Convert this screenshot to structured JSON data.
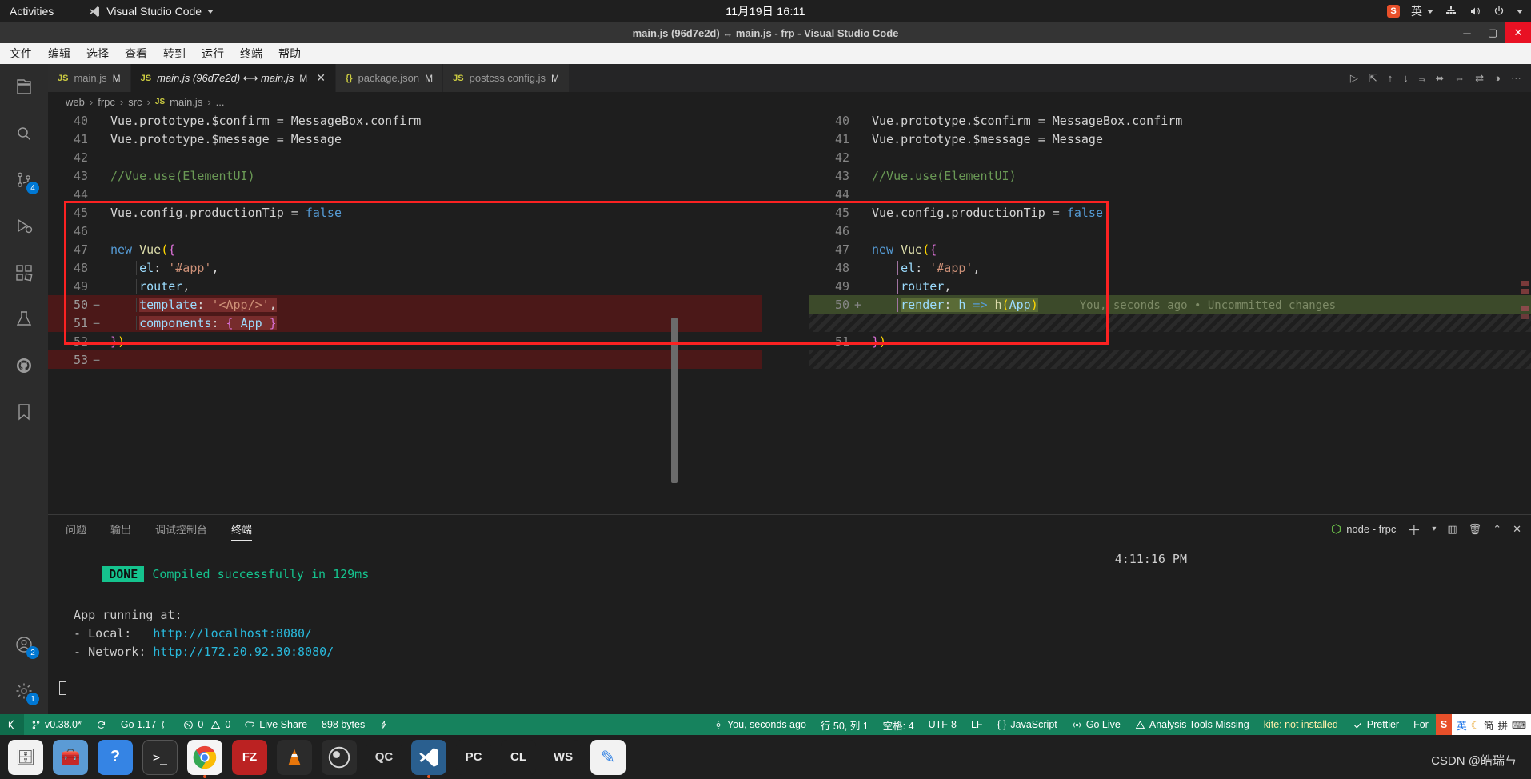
{
  "gnome": {
    "activities": "Activities",
    "app_name": "Visual Studio Code",
    "app_icon": "vscode-icon",
    "clock": "11月19日  16:11",
    "tray": [
      "sogou-ime-icon",
      "input-method-en",
      "network-icon",
      "volume-icon",
      "power-icon",
      "chevron-down-icon"
    ],
    "ime_label": "英"
  },
  "titlebar": {
    "title": "main.js (96d7e2d) ↔ main.js - frp - Visual Studio Code",
    "minimize": "─",
    "maximize": "▢",
    "close": "✕"
  },
  "menubar": {
    "items": [
      "文件",
      "编辑",
      "选择",
      "查看",
      "转到",
      "运行",
      "终端",
      "帮助"
    ]
  },
  "activitybar": {
    "items": [
      {
        "name": "explorer-icon",
        "glyph": "files",
        "badge": null,
        "active": false
      },
      {
        "name": "search-icon",
        "glyph": "search",
        "badge": null,
        "active": false
      },
      {
        "name": "source-control-icon",
        "glyph": "git",
        "badge": "4",
        "active": false
      },
      {
        "name": "run-debug-icon",
        "glyph": "debug",
        "badge": null,
        "active": false
      },
      {
        "name": "extensions-icon",
        "glyph": "ext",
        "badge": null,
        "active": false
      },
      {
        "name": "testing-icon",
        "glyph": "beaker",
        "badge": null,
        "active": false
      },
      {
        "name": "github-icon",
        "glyph": "github",
        "badge": null,
        "active": false
      },
      {
        "name": "bookmarks-icon",
        "glyph": "bookmark",
        "badge": null,
        "active": false
      }
    ],
    "bottom": [
      {
        "name": "accounts-icon",
        "glyph": "account",
        "badge": "2"
      },
      {
        "name": "settings-gear-icon",
        "glyph": "gear",
        "badge": "1"
      }
    ]
  },
  "tabs": [
    {
      "label": "main.js",
      "icon": "js-file-icon",
      "icon_text": "JS",
      "dirty": "M",
      "active": false,
      "closable": false
    },
    {
      "label": "main.js (96d7e2d) ⟷ main.js",
      "icon": "js-file-icon",
      "icon_text": "JS",
      "dirty": "M",
      "active": true,
      "closable": true
    },
    {
      "label": "package.json",
      "icon": "json-file-icon",
      "icon_text": "{}",
      "dirty": "M",
      "active": false,
      "closable": false
    },
    {
      "label": "postcss.config.js",
      "icon": "js-file-icon",
      "icon_text": "JS",
      "dirty": "M",
      "active": false,
      "closable": false
    }
  ],
  "editor_actions": [
    "run-icon",
    "split-editor-icon",
    "prev-change-icon",
    "next-change-icon",
    "filter-icon",
    "toggle-inline-icon",
    "collapse-unchanged-icon",
    "swap-sides-icon",
    "layout-icon",
    "more-actions-icon"
  ],
  "breadcrumb": [
    "web",
    "frpc",
    "src",
    "main.js",
    "..."
  ],
  "breadcrumb_file_icon": "JS",
  "diff": {
    "left_lines": [
      {
        "n": "40",
        "sign": "",
        "state": "ctx",
        "tokens": [
          {
            "t": "Vue",
            "c": "tok-plain"
          },
          {
            "t": ".",
            "c": "tok-plain"
          },
          {
            "t": "prototype",
            "c": "tok-plain"
          },
          {
            "t": ".",
            "c": "tok-plain"
          },
          {
            "t": "$confirm",
            "c": "tok-plain"
          },
          {
            "t": " = ",
            "c": "tok-plain"
          },
          {
            "t": "MessageBox",
            "c": "tok-plain"
          },
          {
            "t": ".",
            "c": "tok-plain"
          },
          {
            "t": "confirm",
            "c": "tok-plain"
          }
        ]
      },
      {
        "n": "41",
        "sign": "",
        "state": "ctx",
        "tokens": [
          {
            "t": "Vue.prototype.$message = Message",
            "c": "tok-plain"
          }
        ]
      },
      {
        "n": "42",
        "sign": "",
        "state": "ctx",
        "tokens": []
      },
      {
        "n": "43",
        "sign": "",
        "state": "ctx",
        "tokens": [
          {
            "t": "//Vue.use(ElementUI)",
            "c": "tok-com"
          }
        ]
      },
      {
        "n": "44",
        "sign": "",
        "state": "ctx",
        "tokens": []
      },
      {
        "n": "45",
        "sign": "",
        "state": "ctx",
        "tokens": [
          {
            "t": "Vue.config.productionTip = ",
            "c": "tok-plain"
          },
          {
            "t": "false",
            "c": "tok-kw"
          }
        ]
      },
      {
        "n": "46",
        "sign": "",
        "state": "ctx",
        "tokens": []
      },
      {
        "n": "47",
        "sign": "",
        "state": "ctx",
        "tokens": [
          {
            "t": "new",
            "c": "tok-kw"
          },
          {
            "t": " ",
            "c": "tok-plain"
          },
          {
            "t": "Vue",
            "c": "tok-fn"
          },
          {
            "t": "(",
            "c": "tok-p1"
          },
          {
            "t": "{",
            "c": "tok-p2"
          }
        ]
      },
      {
        "n": "48",
        "sign": "",
        "state": "ctx",
        "tokens": [
          {
            "t": "    ",
            "c": "tok-plain"
          },
          {
            "t": "el",
            "c": "tok-var"
          },
          {
            "t": ": ",
            "c": "tok-plain"
          },
          {
            "t": "'#app'",
            "c": "tok-str"
          },
          {
            "t": ",",
            "c": "tok-plain"
          }
        ]
      },
      {
        "n": "49",
        "sign": "",
        "state": "ctx",
        "tokens": [
          {
            "t": "    ",
            "c": "tok-plain"
          },
          {
            "t": "router",
            "c": "tok-var"
          },
          {
            "t": ",",
            "c": "tok-plain"
          }
        ]
      },
      {
        "n": "50",
        "sign": "−",
        "state": "del",
        "tokens": [
          {
            "t": "    ",
            "c": "tok-plain"
          },
          {
            "t": "template",
            "c": "tok-var"
          },
          {
            "t": ": ",
            "c": "tok-plain"
          },
          {
            "t": "'<App/>'",
            "c": "tok-str"
          },
          {
            "t": ",",
            "c": "tok-plain"
          }
        ]
      },
      {
        "n": "51",
        "sign": "−",
        "state": "del",
        "tokens": [
          {
            "t": "    ",
            "c": "tok-plain"
          },
          {
            "t": "components",
            "c": "tok-var"
          },
          {
            "t": ": ",
            "c": "tok-plain"
          },
          {
            "t": "{ ",
            "c": "tok-p2"
          },
          {
            "t": "App",
            "c": "tok-var"
          },
          {
            "t": " }",
            "c": "tok-p2"
          }
        ]
      },
      {
        "n": "52",
        "sign": "",
        "state": "ctx",
        "tokens": [
          {
            "t": "}",
            "c": "tok-p2"
          },
          {
            "t": ")",
            "c": "tok-p1"
          }
        ]
      },
      {
        "n": "53",
        "sign": "−",
        "state": "del",
        "tokens": []
      }
    ],
    "right_lines": [
      {
        "n": "40",
        "sign": "",
        "state": "ctx",
        "tokens": [
          {
            "t": "Vue.prototype.$confirm = MessageBox.confirm",
            "c": "tok-plain"
          }
        ]
      },
      {
        "n": "41",
        "sign": "",
        "state": "ctx",
        "tokens": [
          {
            "t": "Vue.prototype.$message = Message",
            "c": "tok-plain"
          }
        ]
      },
      {
        "n": "42",
        "sign": "",
        "state": "ctx",
        "tokens": []
      },
      {
        "n": "43",
        "sign": "",
        "state": "ctx",
        "tokens": [
          {
            "t": "//Vue.use(ElementUI)",
            "c": "tok-com"
          }
        ]
      },
      {
        "n": "44",
        "sign": "",
        "state": "ctx",
        "tokens": []
      },
      {
        "n": "45",
        "sign": "",
        "state": "ctx",
        "tokens": [
          {
            "t": "Vue.config.productionTip = ",
            "c": "tok-plain"
          },
          {
            "t": "false",
            "c": "tok-kw"
          }
        ]
      },
      {
        "n": "46",
        "sign": "",
        "state": "ctx",
        "tokens": []
      },
      {
        "n": "47",
        "sign": "",
        "state": "ctx",
        "tokens": [
          {
            "t": "new",
            "c": "tok-kw"
          },
          {
            "t": " ",
            "c": "tok-plain"
          },
          {
            "t": "Vue",
            "c": "tok-fn"
          },
          {
            "t": "(",
            "c": "tok-p1"
          },
          {
            "t": "{",
            "c": "tok-p2"
          }
        ]
      },
      {
        "n": "48",
        "sign": "",
        "state": "ctx",
        "tokens": [
          {
            "t": "    ",
            "c": "tok-plain"
          },
          {
            "t": "el",
            "c": "tok-var"
          },
          {
            "t": ": ",
            "c": "tok-plain"
          },
          {
            "t": "'#app'",
            "c": "tok-str"
          },
          {
            "t": ",",
            "c": "tok-plain"
          }
        ]
      },
      {
        "n": "49",
        "sign": "",
        "state": "ctx",
        "tokens": [
          {
            "t": "    ",
            "c": "tok-plain"
          },
          {
            "t": "router",
            "c": "tok-var"
          },
          {
            "t": ",",
            "c": "tok-plain"
          }
        ]
      },
      {
        "n": "50",
        "sign": "+",
        "state": "add",
        "tokens": [
          {
            "t": "    ",
            "c": "tok-plain"
          },
          {
            "t": "render",
            "c": "tok-var"
          },
          {
            "t": ": ",
            "c": "tok-plain"
          },
          {
            "t": "h",
            "c": "tok-var"
          },
          {
            "t": " => ",
            "c": "tok-kw"
          },
          {
            "t": "h",
            "c": "tok-fn"
          },
          {
            "t": "(",
            "c": "tok-p1"
          },
          {
            "t": "App",
            "c": "tok-var"
          },
          {
            "t": ")",
            "c": "tok-p1"
          }
        ]
      },
      {
        "n": "",
        "sign": "",
        "state": "hatch",
        "tokens": []
      },
      {
        "n": "51",
        "sign": "",
        "state": "ctx",
        "tokens": [
          {
            "t": "}",
            "c": "tok-p2"
          },
          {
            "t": ")",
            "c": "tok-p1"
          }
        ]
      },
      {
        "n": "",
        "sign": "",
        "state": "hatch",
        "tokens": []
      }
    ],
    "blame_annotation": "You, seconds ago • Uncommitted changes"
  },
  "panel": {
    "tabs": [
      "问题",
      "输出",
      "调试控制台",
      "终端"
    ],
    "active_tab": "终端",
    "terminal_name": "node - frpc",
    "actions": [
      "new-terminal-icon",
      "terminal-dropdown-icon",
      "split-terminal-icon",
      "kill-terminal-icon",
      "maximize-panel-icon",
      "close-panel-icon"
    ],
    "terminal_lines": [
      {
        "badge": "DONE",
        "text": " Compiled successfully in 129ms",
        "cls": "term-green"
      },
      {
        "badge": null,
        "text": "",
        "cls": ""
      },
      {
        "badge": null,
        "text": "  App running at:",
        "cls": ""
      },
      {
        "badge": null,
        "text": "  - Local:   ",
        "link": "http://localhost:8080/",
        "cls": ""
      },
      {
        "badge": null,
        "text": "  - Network: ",
        "link": "http://172.20.92.30:8080/",
        "cls": ""
      }
    ],
    "terminal_time": "4:11:16 PM",
    "local_url": "http://localhost:8080/",
    "network_url": "http://172.20.92.30:8080/",
    "local_label": "  - Local:   ",
    "network_label": "  - Network: ",
    "app_running_label": "  App running at:",
    "done_badge": "DONE",
    "done_text": "Compiled successfully in 129ms"
  },
  "statusbar": {
    "remote_icon": "remote-indicator-icon",
    "left": [
      {
        "name": "branch-status",
        "icon": "git-branch-icon",
        "label": "v0.38.0*"
      },
      {
        "name": "sync-status",
        "icon": "sync-icon",
        "label": ""
      },
      {
        "name": "go-version-status",
        "icon": "",
        "label": "Go 1.17"
      },
      {
        "name": "problems-status",
        "icon": "error-icon",
        "label": "0  0"
      },
      {
        "name": "live-share-status",
        "icon": "live-share-icon",
        "label": "Live Share"
      },
      {
        "name": "file-size-status",
        "icon": "",
        "label": "898 bytes"
      }
    ],
    "go_label": "Go 1.17",
    "errors": "0",
    "warnings": "0",
    "live_share": "Live Share",
    "file_size": "898 bytes",
    "branch": "v0.38.0*",
    "right": [
      {
        "name": "git-blame-status",
        "label": "You, seconds ago"
      },
      {
        "name": "cursor-position-status",
        "label": "行 50, 列 1"
      },
      {
        "name": "indentation-status",
        "label": "空格: 4"
      },
      {
        "name": "encoding-status",
        "label": "UTF-8"
      },
      {
        "name": "eol-status",
        "label": "LF"
      },
      {
        "name": "language-mode-status",
        "label": "JavaScript"
      },
      {
        "name": "go-live-status",
        "label": "Go Live"
      },
      {
        "name": "analysis-tools-status",
        "label": "Analysis Tools Missing"
      },
      {
        "name": "kite-status",
        "label": "kite: not installed"
      },
      {
        "name": "prettier-status",
        "label": "Prettier"
      },
      {
        "name": "format-status",
        "label": "For"
      }
    ],
    "blame": "You, seconds ago",
    "position": "行 50, 列 1",
    "indent": "空格: 4",
    "encoding": "UTF-8",
    "eol": "LF",
    "language": "JavaScript",
    "go_live": "Go Live",
    "analysis": "Analysis Tools Missing",
    "kite": "kite: not installed",
    "prettier": "Prettier",
    "format": "For",
    "ime_en": "英",
    "ime_simplified": "简",
    "ime_pinyin": "拼"
  },
  "dock": {
    "items": [
      {
        "name": "files-app",
        "glyph": "🗄",
        "color": "#f0f0f0",
        "running": false
      },
      {
        "name": "software-app",
        "glyph": "🧰",
        "color": "#5b9bd5",
        "running": false
      },
      {
        "name": "help-app",
        "glyph": "?",
        "color": "#3584e4",
        "running": false
      },
      {
        "name": "terminal-app",
        "glyph": ">_",
        "color": "#2b2b2b",
        "running": false
      },
      {
        "name": "chrome-app",
        "glyph": "◉",
        "color": "#f5f5f5",
        "running": true
      },
      {
        "name": "filezilla-app",
        "glyph": "FZ",
        "color": "#b01818",
        "running": false
      },
      {
        "name": "vlc-app",
        "glyph": "▲",
        "color": "#2b2b2b",
        "running": false
      },
      {
        "name": "obs-app",
        "glyph": "◎",
        "color": "#2b2b2b",
        "running": false
      },
      {
        "name": "qc-app",
        "glyph": "QC",
        "color": "#1f1f1f",
        "running": false
      },
      {
        "name": "vscode-app",
        "glyph": "✕",
        "color": "#2a5f8f",
        "running": true
      },
      {
        "name": "pycharm-app",
        "glyph": "PC",
        "color": "#1f1f1f",
        "running": false
      },
      {
        "name": "clion-app",
        "glyph": "CL",
        "color": "#1f1f1f",
        "running": false
      },
      {
        "name": "webstorm-app",
        "glyph": "WS",
        "color": "#1f1f1f",
        "running": false
      },
      {
        "name": "text-editor-app",
        "glyph": "✎",
        "color": "#f0f0f0",
        "running": false
      }
    ]
  },
  "watermark": "CSDN @皓瑞ㄣ"
}
